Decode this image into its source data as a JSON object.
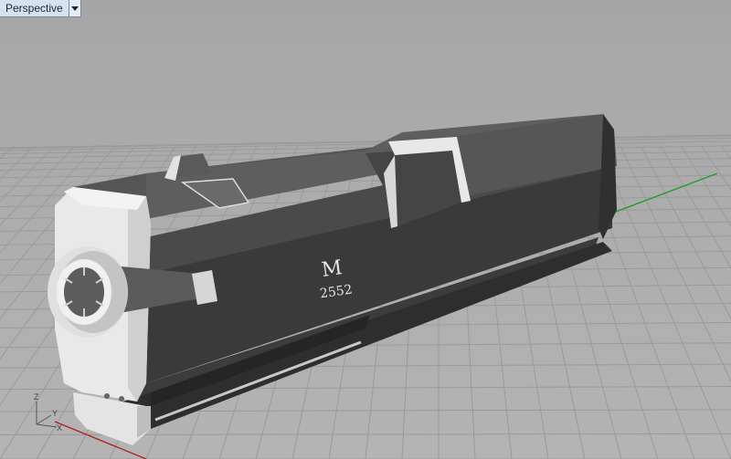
{
  "viewport": {
    "title": "Perspective",
    "menu_icon": "dropdown-arrow-icon"
  },
  "model": {
    "engraving_letter": "M",
    "engraving_number": "2552"
  },
  "axis_triad": {
    "z_label": "Z",
    "y_label": "Y",
    "x_label": "X"
  },
  "colors": {
    "background": "#a8a8a8",
    "grid_line": "#9a9a9a",
    "x_axis": "#b02020",
    "y_axis": "#1f9a2a"
  }
}
